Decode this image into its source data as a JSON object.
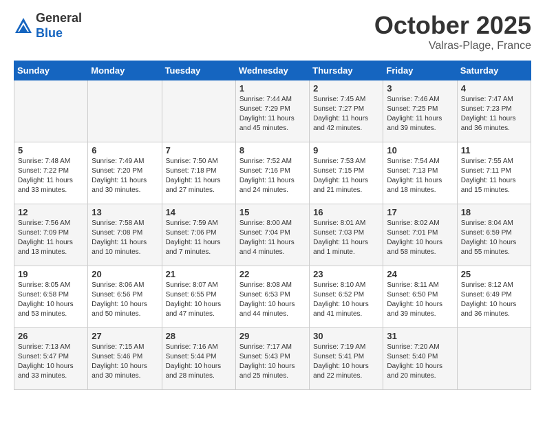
{
  "header": {
    "logo_general": "General",
    "logo_blue": "Blue",
    "month_title": "October 2025",
    "location": "Valras-Plage, France"
  },
  "days_of_week": [
    "Sunday",
    "Monday",
    "Tuesday",
    "Wednesday",
    "Thursday",
    "Friday",
    "Saturday"
  ],
  "weeks": [
    [
      {
        "day": "",
        "info": ""
      },
      {
        "day": "",
        "info": ""
      },
      {
        "day": "",
        "info": ""
      },
      {
        "day": "1",
        "info": "Sunrise: 7:44 AM\nSunset: 7:29 PM\nDaylight: 11 hours\nand 45 minutes."
      },
      {
        "day": "2",
        "info": "Sunrise: 7:45 AM\nSunset: 7:27 PM\nDaylight: 11 hours\nand 42 minutes."
      },
      {
        "day": "3",
        "info": "Sunrise: 7:46 AM\nSunset: 7:25 PM\nDaylight: 11 hours\nand 39 minutes."
      },
      {
        "day": "4",
        "info": "Sunrise: 7:47 AM\nSunset: 7:23 PM\nDaylight: 11 hours\nand 36 minutes."
      }
    ],
    [
      {
        "day": "5",
        "info": "Sunrise: 7:48 AM\nSunset: 7:22 PM\nDaylight: 11 hours\nand 33 minutes."
      },
      {
        "day": "6",
        "info": "Sunrise: 7:49 AM\nSunset: 7:20 PM\nDaylight: 11 hours\nand 30 minutes."
      },
      {
        "day": "7",
        "info": "Sunrise: 7:50 AM\nSunset: 7:18 PM\nDaylight: 11 hours\nand 27 minutes."
      },
      {
        "day": "8",
        "info": "Sunrise: 7:52 AM\nSunset: 7:16 PM\nDaylight: 11 hours\nand 24 minutes."
      },
      {
        "day": "9",
        "info": "Sunrise: 7:53 AM\nSunset: 7:15 PM\nDaylight: 11 hours\nand 21 minutes."
      },
      {
        "day": "10",
        "info": "Sunrise: 7:54 AM\nSunset: 7:13 PM\nDaylight: 11 hours\nand 18 minutes."
      },
      {
        "day": "11",
        "info": "Sunrise: 7:55 AM\nSunset: 7:11 PM\nDaylight: 11 hours\nand 15 minutes."
      }
    ],
    [
      {
        "day": "12",
        "info": "Sunrise: 7:56 AM\nSunset: 7:09 PM\nDaylight: 11 hours\nand 13 minutes."
      },
      {
        "day": "13",
        "info": "Sunrise: 7:58 AM\nSunset: 7:08 PM\nDaylight: 11 hours\nand 10 minutes."
      },
      {
        "day": "14",
        "info": "Sunrise: 7:59 AM\nSunset: 7:06 PM\nDaylight: 11 hours\nand 7 minutes."
      },
      {
        "day": "15",
        "info": "Sunrise: 8:00 AM\nSunset: 7:04 PM\nDaylight: 11 hours\nand 4 minutes."
      },
      {
        "day": "16",
        "info": "Sunrise: 8:01 AM\nSunset: 7:03 PM\nDaylight: 11 hours\nand 1 minute."
      },
      {
        "day": "17",
        "info": "Sunrise: 8:02 AM\nSunset: 7:01 PM\nDaylight: 10 hours\nand 58 minutes."
      },
      {
        "day": "18",
        "info": "Sunrise: 8:04 AM\nSunset: 6:59 PM\nDaylight: 10 hours\nand 55 minutes."
      }
    ],
    [
      {
        "day": "19",
        "info": "Sunrise: 8:05 AM\nSunset: 6:58 PM\nDaylight: 10 hours\nand 53 minutes."
      },
      {
        "day": "20",
        "info": "Sunrise: 8:06 AM\nSunset: 6:56 PM\nDaylight: 10 hours\nand 50 minutes."
      },
      {
        "day": "21",
        "info": "Sunrise: 8:07 AM\nSunset: 6:55 PM\nDaylight: 10 hours\nand 47 minutes."
      },
      {
        "day": "22",
        "info": "Sunrise: 8:08 AM\nSunset: 6:53 PM\nDaylight: 10 hours\nand 44 minutes."
      },
      {
        "day": "23",
        "info": "Sunrise: 8:10 AM\nSunset: 6:52 PM\nDaylight: 10 hours\nand 41 minutes."
      },
      {
        "day": "24",
        "info": "Sunrise: 8:11 AM\nSunset: 6:50 PM\nDaylight: 10 hours\nand 39 minutes."
      },
      {
        "day": "25",
        "info": "Sunrise: 8:12 AM\nSunset: 6:49 PM\nDaylight: 10 hours\nand 36 minutes."
      }
    ],
    [
      {
        "day": "26",
        "info": "Sunrise: 7:13 AM\nSunset: 5:47 PM\nDaylight: 10 hours\nand 33 minutes."
      },
      {
        "day": "27",
        "info": "Sunrise: 7:15 AM\nSunset: 5:46 PM\nDaylight: 10 hours\nand 30 minutes."
      },
      {
        "day": "28",
        "info": "Sunrise: 7:16 AM\nSunset: 5:44 PM\nDaylight: 10 hours\nand 28 minutes."
      },
      {
        "day": "29",
        "info": "Sunrise: 7:17 AM\nSunset: 5:43 PM\nDaylight: 10 hours\nand 25 minutes."
      },
      {
        "day": "30",
        "info": "Sunrise: 7:19 AM\nSunset: 5:41 PM\nDaylight: 10 hours\nand 22 minutes."
      },
      {
        "day": "31",
        "info": "Sunrise: 7:20 AM\nSunset: 5:40 PM\nDaylight: 10 hours\nand 20 minutes."
      },
      {
        "day": "",
        "info": ""
      }
    ]
  ]
}
